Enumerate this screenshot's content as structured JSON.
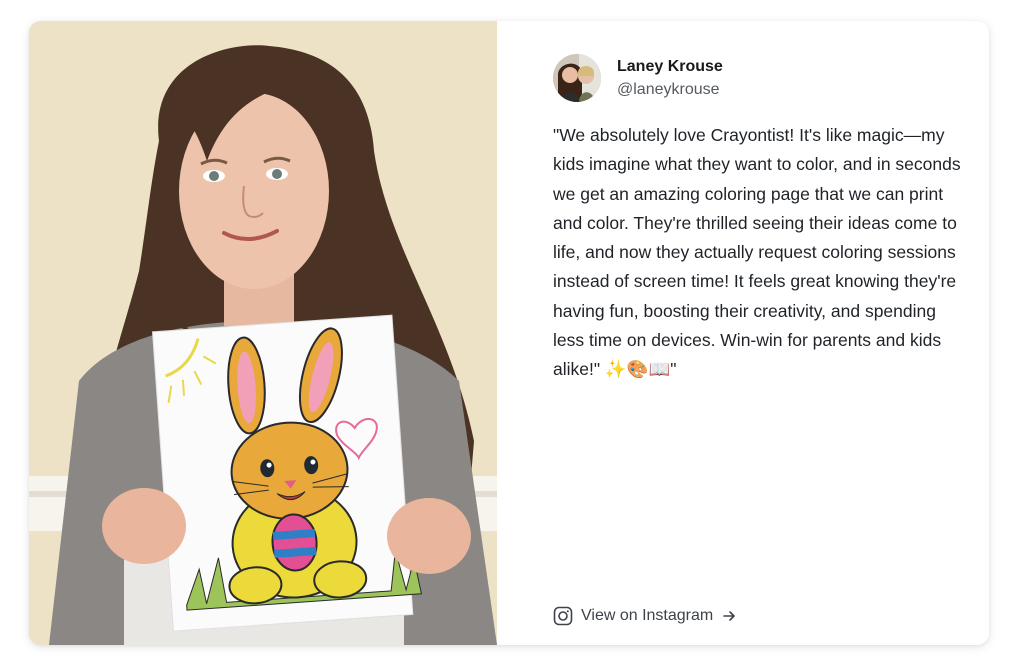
{
  "testimonial": {
    "author_name": "Laney Krouse",
    "author_handle": "@laneykrouse",
    "quote": "\"We absolutely love Crayontist! It's like magic—my kids imagine what they want to color, and in seconds we get an amazing coloring page that we can print and color. They're thrilled seeing their ideas come to life, and now they actually request coloring sessions instead of screen time! It feels great knowing they're having fun, boosting their creativity, and spending less time on devices. Win-win for parents and kids alike!\" ✨🎨📖\"",
    "link_label": "View on Instagram",
    "link_icon": "instagram-icon",
    "arrow_icon": "arrow-right-icon"
  },
  "colors": {
    "text": "#1f2328",
    "muted": "#555a60",
    "link": "#3d434a"
  }
}
